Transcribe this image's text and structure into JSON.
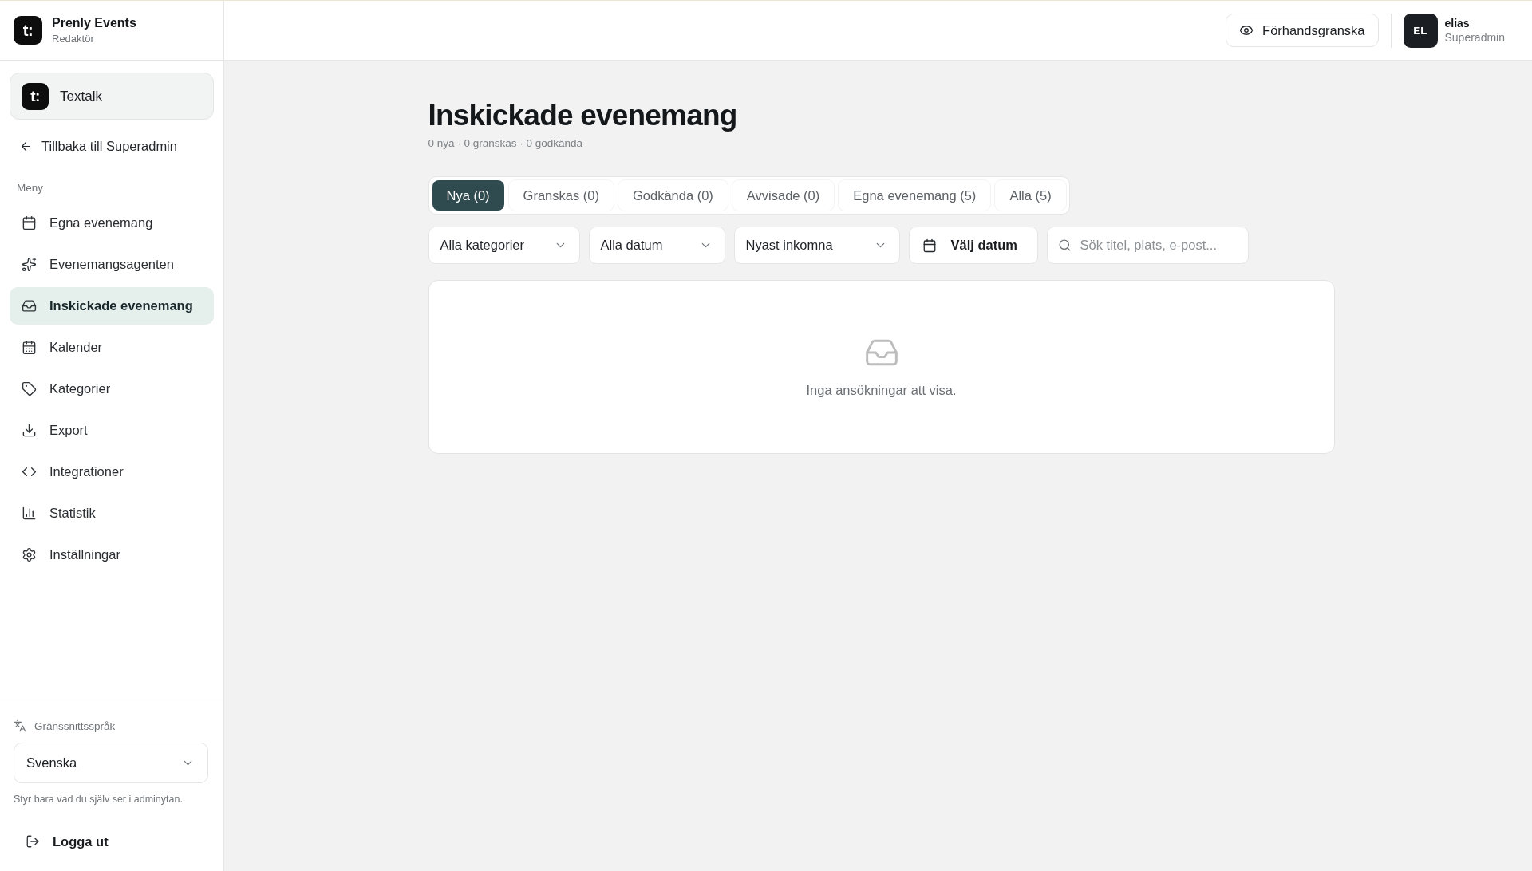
{
  "sidebar": {
    "brand": {
      "logo": "t:",
      "name": "Prenly Events",
      "role": "Redaktör"
    },
    "organization": {
      "logo": "t:",
      "name": "Textalk"
    },
    "back_link": "Tillbaka till Superadmin",
    "menu_heading": "Meny",
    "menu_items": [
      {
        "label": "Egna evenemang",
        "selected": false
      },
      {
        "label": "Evenemangsagenten",
        "selected": false
      },
      {
        "label": "Inskickade evenemang",
        "selected": true
      },
      {
        "label": "Kalender",
        "selected": false
      },
      {
        "label": "Kategorier",
        "selected": false
      },
      {
        "label": "Export",
        "selected": false
      },
      {
        "label": "Integrationer",
        "selected": false
      },
      {
        "label": "Statistik",
        "selected": false
      },
      {
        "label": "Inställningar",
        "selected": false
      }
    ],
    "language": {
      "label": "Gränssnittsspråk",
      "value": "Svenska",
      "hint": "Styr bara vad du själv ser i adminytan."
    },
    "logout": "Logga ut"
  },
  "header": {
    "preview_button": "Förhandsgranska",
    "user": {
      "initials": "EL",
      "name": "elias",
      "role": "Superadmin"
    }
  },
  "page": {
    "title": "Inskickade evenemang",
    "summary": "0 nya · 0 granskas · 0 godkända",
    "tabs": [
      {
        "label": "Nya (0)",
        "selected": true
      },
      {
        "label": "Granskas (0)",
        "selected": false
      },
      {
        "label": "Godkända (0)",
        "selected": false
      },
      {
        "label": "Avvisade (0)",
        "selected": false
      },
      {
        "label": "Egna evenemang (5)",
        "selected": false
      },
      {
        "label": "Alla (5)",
        "selected": false
      }
    ],
    "filters": [
      {
        "kind": "select",
        "value": "Alla kategorier"
      },
      {
        "kind": "select",
        "value": "Alla datum"
      },
      {
        "kind": "select",
        "value": "Nyast inkomna"
      },
      {
        "kind": "date",
        "label": "Välj datum"
      },
      {
        "kind": "search",
        "placeholder": "Sök titel, plats, e-post..."
      }
    ],
    "empty_state": {
      "message": "Inga ansökningar att visa."
    }
  }
}
